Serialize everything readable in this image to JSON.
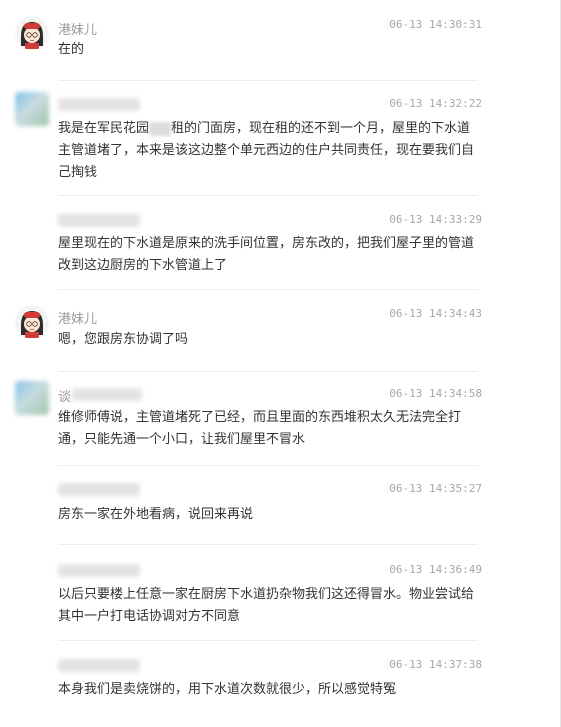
{
  "messages": [
    {
      "sender": "港妹儿",
      "time": "06-13 14:30:31",
      "content": "在的"
    },
    {
      "sender": "",
      "time": "06-13 14:32:22",
      "content_a": "我是在军民花园",
      "content_b": "租的门面房，现在租的还不到一个月，屋里的下水道主管道堵了，本来是该这边整个单元西边的住户共同责任，现在要我们自己掏钱"
    },
    {
      "sender": "",
      "time": "06-13 14:33:29",
      "content": "屋里现在的下水道是原来的洗手间位置，房东改的，把我们屋子里的管道改到这边厨房的下水管道上了"
    },
    {
      "sender": "港妹儿",
      "time": "06-13 14:34:43",
      "content": "嗯，您跟房东协调了吗"
    },
    {
      "sender": "谈",
      "time": "06-13 14:34:58",
      "content": "维修师傅说，主管道堵死了已经，而且里面的东西堆积太久无法完全打通，只能先通一个小口，让我们屋里不冒水"
    },
    {
      "sender": "",
      "time": "06-13 14:35:27",
      "content": "房东一家在外地看病，说回来再说"
    },
    {
      "sender": "",
      "time": "06-13 14:36:49",
      "content": "以后只要楼上任意一家在厨房下水道扔杂物我们这还得冒水。物业尝试给其中一户打电话协调对方不同意"
    },
    {
      "sender": "",
      "time": "06-13 14:37:38",
      "content": "本身我们是卖烧饼的，用下水道次数就很少，所以感觉特冤"
    }
  ]
}
